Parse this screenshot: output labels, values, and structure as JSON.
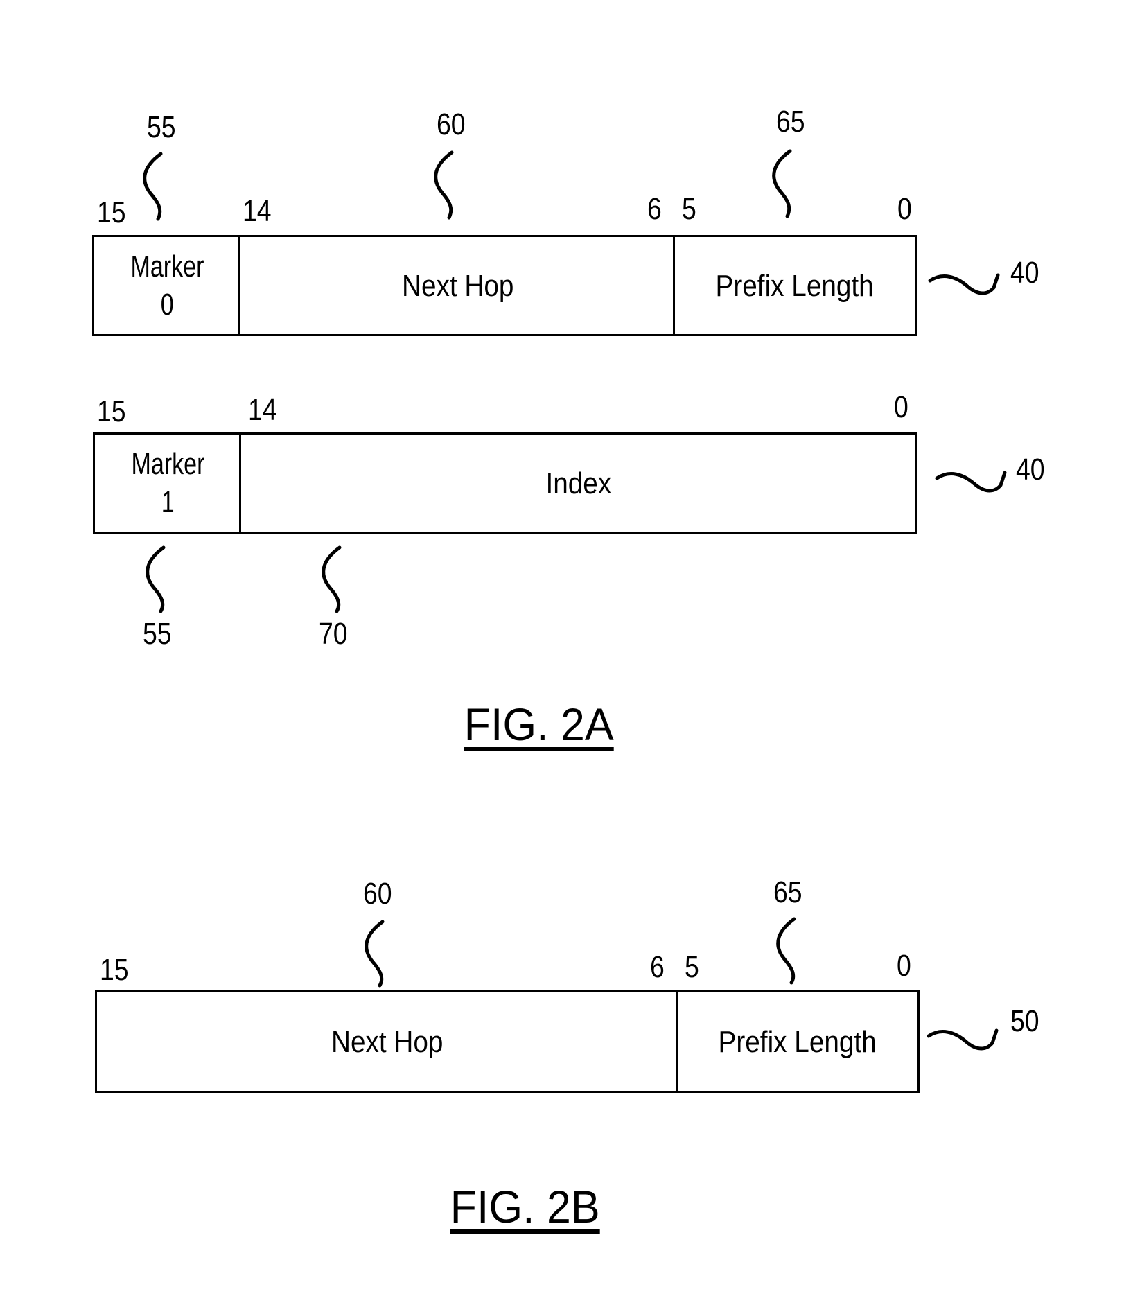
{
  "fig2a": {
    "caption": "FIG. 2A",
    "entry_marker0": {
      "ref": "40",
      "bit_labels": [
        "15",
        "14",
        "6",
        "5",
        "0"
      ],
      "fields": [
        {
          "name": "Marker",
          "value": "0",
          "ref": "55"
        },
        {
          "name": "Next Hop",
          "ref": "60"
        },
        {
          "name": "Prefix Length",
          "ref": "65"
        }
      ]
    },
    "entry_marker1": {
      "ref": "40",
      "bit_labels": [
        "15",
        "14",
        "0"
      ],
      "fields": [
        {
          "name": "Marker",
          "value": "1",
          "ref": "55"
        },
        {
          "name": "Index",
          "ref": "70"
        }
      ]
    }
  },
  "fig2b": {
    "caption": "FIG. 2B",
    "entry": {
      "ref": "50",
      "bit_labels": [
        "15",
        "6",
        "5",
        "0"
      ],
      "fields": [
        {
          "name": "Next Hop",
          "ref": "60"
        },
        {
          "name": "Prefix Length",
          "ref": "65"
        }
      ]
    }
  }
}
